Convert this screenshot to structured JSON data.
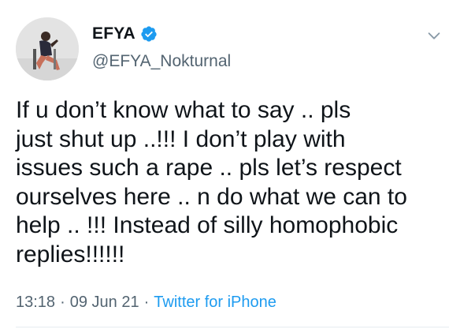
{
  "tweet": {
    "author": {
      "display_name": "EFYA",
      "handle": "@EFYA_Nokturnal",
      "verified_icon": "verified-badge-icon",
      "avatar_icon": "avatar"
    },
    "menu_icon": "chevron-down-icon",
    "text": "If u don’t know what to say .. pls\njust shut up ..!!! I don’t play with\nissues such a rape .. pls let’s respect\nourselves here .. n do what we can to\nhelp .. !!! Instead of silly homophobic\nreplies!!!!!!",
    "time": "13:18",
    "date": "09 Jun 21",
    "source": "Twitter for iPhone",
    "separator": "·"
  },
  "colors": {
    "text": "#0f1419",
    "muted": "#536471",
    "link": "#1d9bf0",
    "verified": "#1d9bf0",
    "divider": "#e6ecf0"
  }
}
